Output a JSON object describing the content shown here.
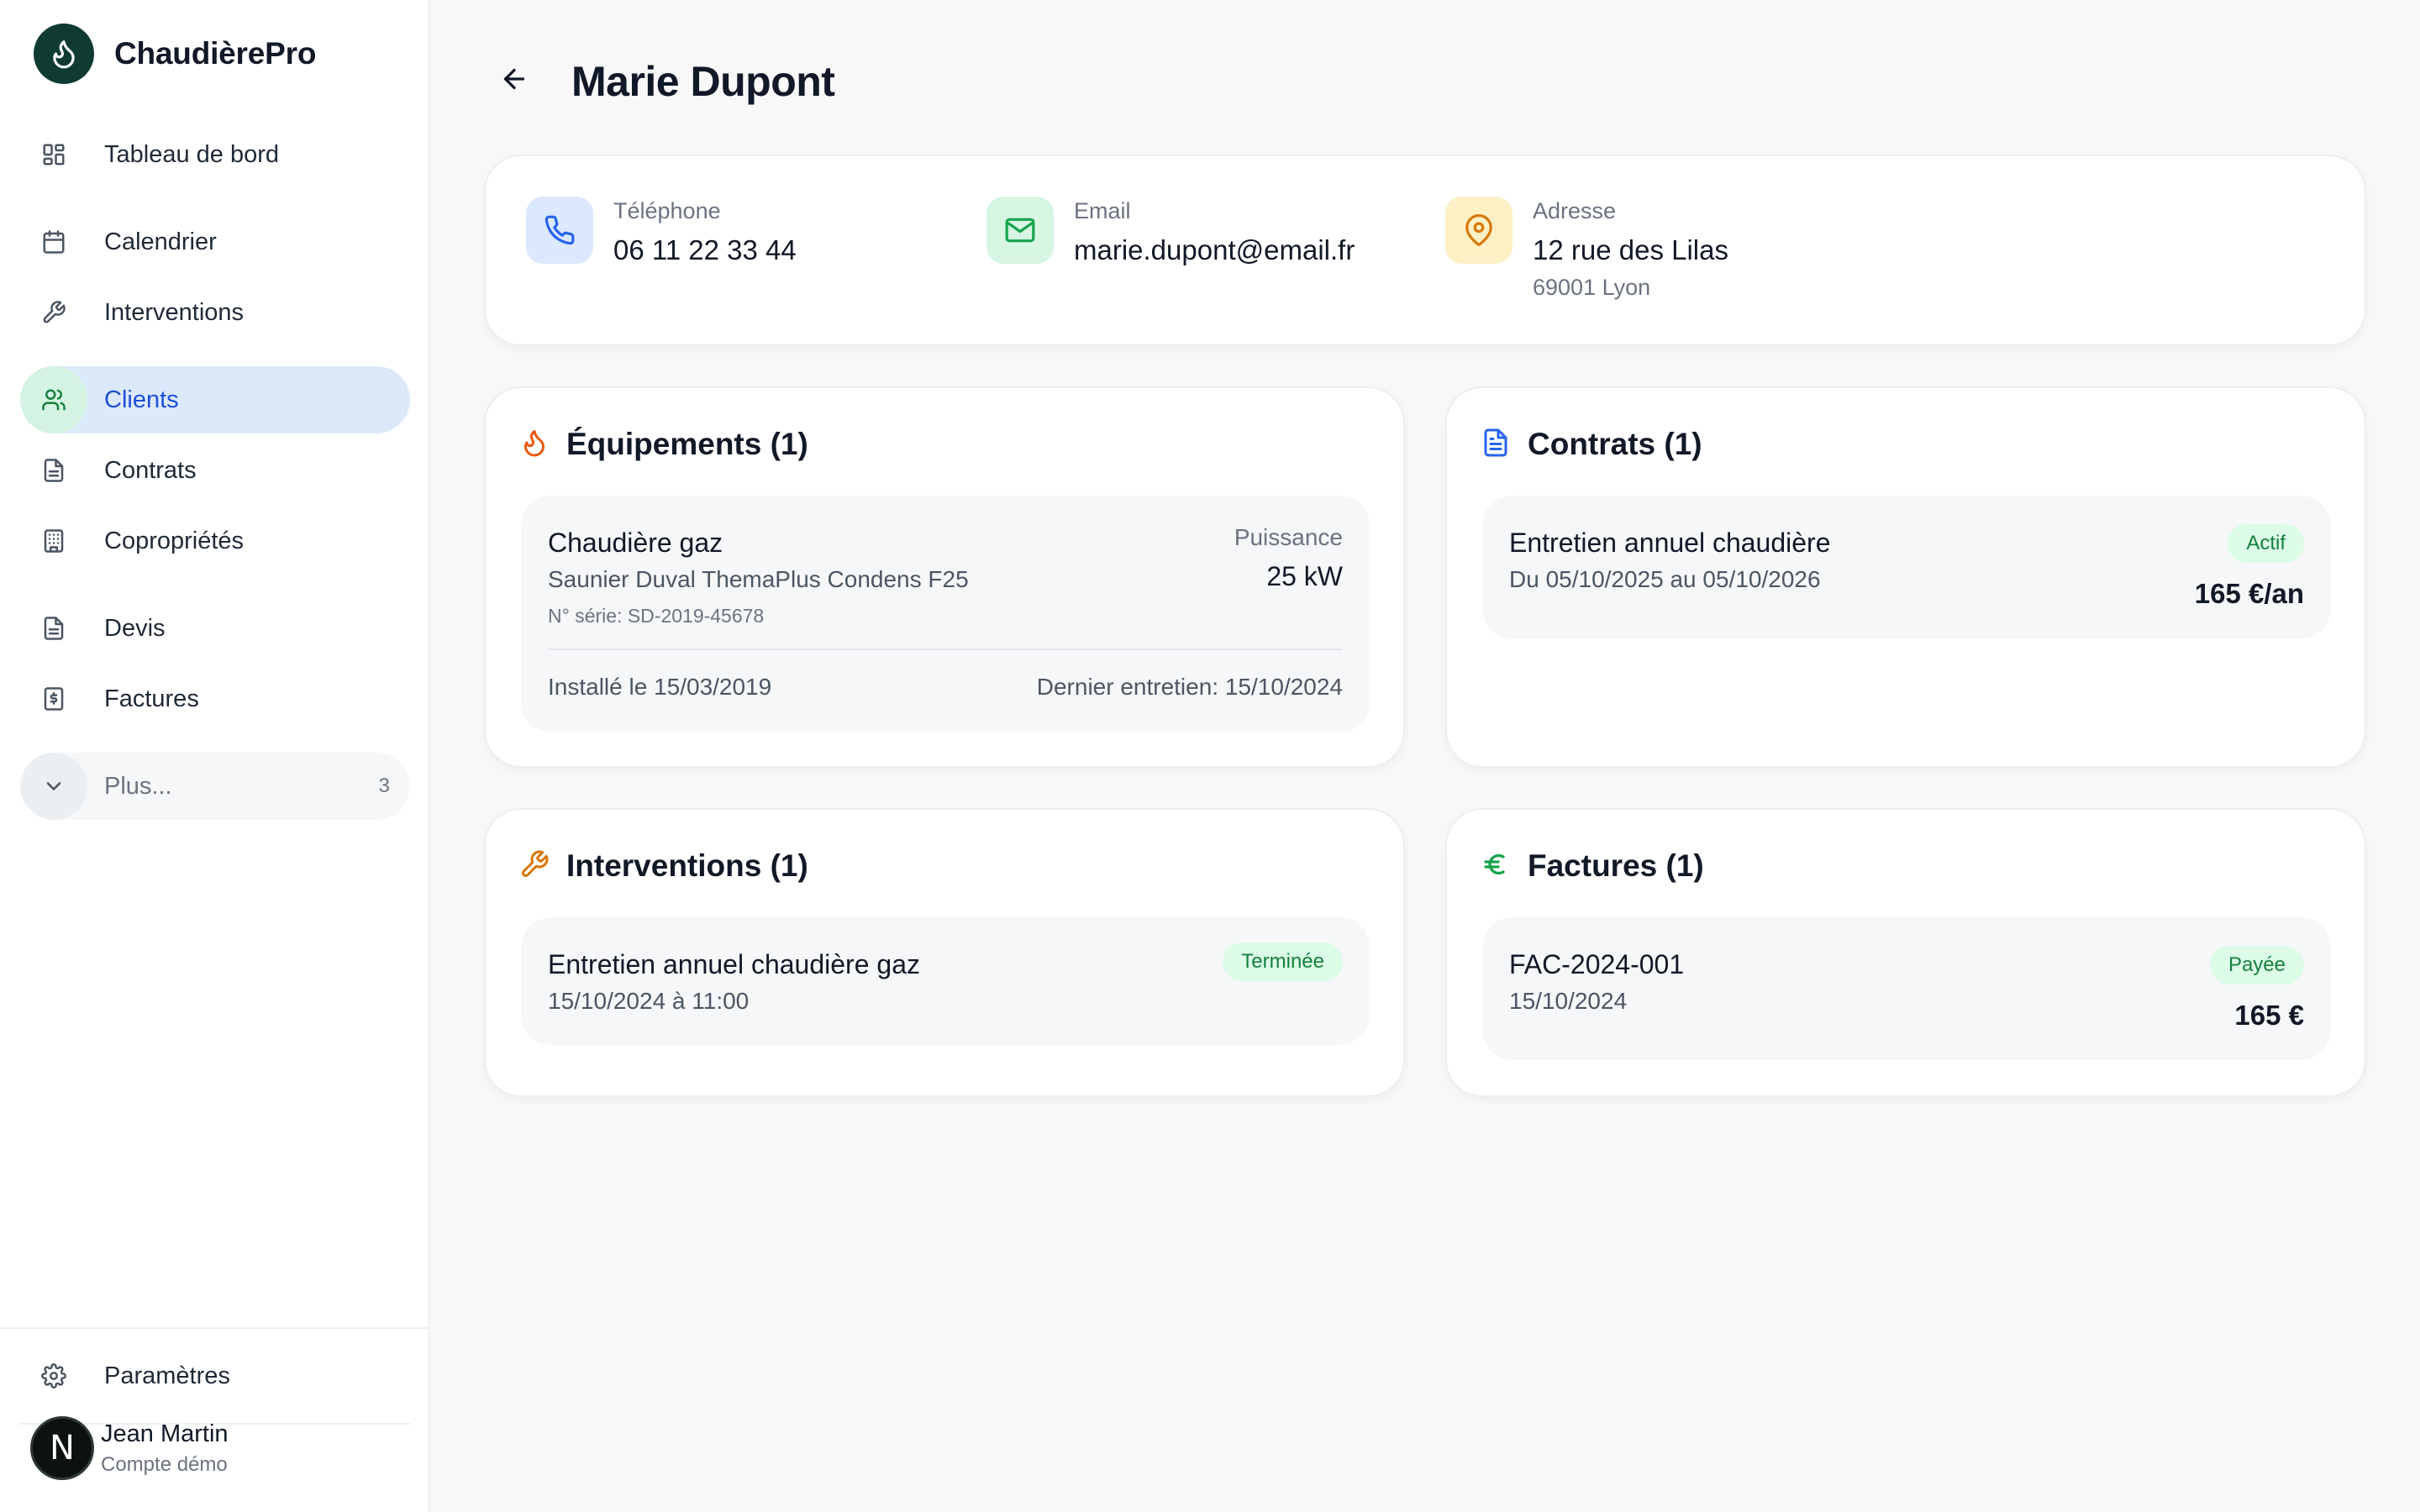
{
  "app": {
    "name": "ChaudièrePro"
  },
  "sidebar": {
    "items": [
      {
        "label": "Tableau de bord",
        "icon": "dashboard-icon"
      },
      {
        "label": "Calendrier",
        "icon": "calendar-icon"
      },
      {
        "label": "Interventions",
        "icon": "wrench-icon"
      },
      {
        "label": "Clients",
        "icon": "users-icon",
        "active": true
      },
      {
        "label": "Contrats",
        "icon": "document-icon"
      },
      {
        "label": "Copropriétés",
        "icon": "building-icon"
      },
      {
        "label": "Devis",
        "icon": "document-icon"
      },
      {
        "label": "Factures",
        "icon": "invoice-icon"
      }
    ],
    "more": {
      "label": "Plus...",
      "count": "3"
    },
    "settings": {
      "label": "Paramètres"
    },
    "user": {
      "initial": "N",
      "name": "Jean Martin",
      "subtitle": "Compte démo"
    }
  },
  "page": {
    "title": "Marie Dupont"
  },
  "contact": {
    "phone": {
      "label": "Téléphone",
      "value": "06 11 22 33 44"
    },
    "email": {
      "label": "Email",
      "value": "marie.dupont@email.fr"
    },
    "address": {
      "label": "Adresse",
      "line1": "12 rue des Lilas",
      "line2": "69001 Lyon"
    }
  },
  "equipements": {
    "title": "Équipements (1)",
    "item": {
      "name": "Chaudière gaz",
      "model": "Saunier Duval ThemaPlus Condens F25",
      "serial": "N° série: SD-2019-45678",
      "power_label": "Puissance",
      "power_value": "25 kW",
      "installed": "Installé le 15/03/2019",
      "last_service": "Dernier entretien: 15/10/2024"
    }
  },
  "contrats": {
    "title": "Contrats (1)",
    "item": {
      "name": "Entretien annuel chaudière",
      "period": "Du 05/10/2025 au 05/10/2026",
      "status": "Actif",
      "price": "165 €/an"
    }
  },
  "interventions": {
    "title": "Interventions (1)",
    "item": {
      "name": "Entretien annuel chaudière gaz",
      "datetime": "15/10/2024 à 11:00",
      "status": "Terminée"
    }
  },
  "factures": {
    "title": "Factures (1)",
    "item": {
      "number": "FAC-2024-001",
      "date": "15/10/2024",
      "status": "Payée",
      "amount": "165 €"
    }
  },
  "colors": {
    "brand": "#0f3b33",
    "active_bg": "#dce9fb",
    "active_text": "#1d4ed8",
    "success_bg": "#dcfce7",
    "success_text": "#15803d",
    "orange": "#ea580c",
    "blue": "#2563eb",
    "amber": "#d97706",
    "green": "#16a34a"
  }
}
